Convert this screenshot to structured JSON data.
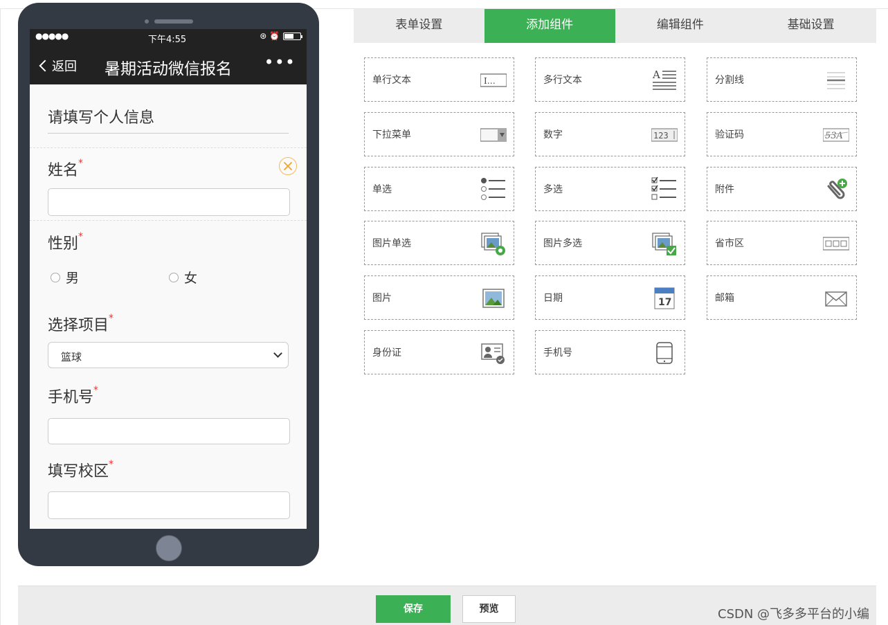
{
  "phone": {
    "status": {
      "signal": "●●●●●",
      "time": "下午4:55",
      "icons": "⊛ ⏰"
    },
    "nav": {
      "back_label": "返回",
      "title": "暑期活动微信报名",
      "more": "•••"
    },
    "form": {
      "heading": "请填写个人信息",
      "required_mark": "*",
      "name_label": "姓名",
      "gender_label": "性别",
      "gender_options": [
        "男",
        "女"
      ],
      "project_label": "选择项目",
      "project_selected": "篮球",
      "phone_label": "手机号",
      "campus_label": "填写校区"
    }
  },
  "tabs": [
    {
      "label": "表单设置",
      "active": false
    },
    {
      "label": "添加组件",
      "active": true
    },
    {
      "label": "编辑组件",
      "active": false
    },
    {
      "label": "基础设置",
      "active": false
    }
  ],
  "components": [
    {
      "label": "单行文本",
      "icon": "single-line-text-icon"
    },
    {
      "label": "多行文本",
      "icon": "multi-line-text-icon"
    },
    {
      "label": "分割线",
      "icon": "divider-icon"
    },
    {
      "label": "下拉菜单",
      "icon": "dropdown-icon"
    },
    {
      "label": "数字",
      "icon": "number-icon"
    },
    {
      "label": "验证码",
      "icon": "captcha-icon"
    },
    {
      "label": "单选",
      "icon": "radio-list-icon"
    },
    {
      "label": "多选",
      "icon": "checkbox-list-icon"
    },
    {
      "label": "附件",
      "icon": "attachment-icon"
    },
    {
      "label": "图片单选",
      "icon": "image-radio-icon"
    },
    {
      "label": "图片多选",
      "icon": "image-checkbox-icon"
    },
    {
      "label": "省市区",
      "icon": "region-icon"
    },
    {
      "label": "图片",
      "icon": "image-icon"
    },
    {
      "label": "日期",
      "icon": "calendar-icon"
    },
    {
      "label": "邮箱",
      "icon": "email-icon"
    },
    {
      "label": "身份证",
      "icon": "id-card-icon"
    },
    {
      "label": "手机号",
      "icon": "mobile-phone-icon"
    }
  ],
  "icon_text": {
    "single_line": "I…",
    "number": "123",
    "captcha": "53A",
    "calendar_day": "17"
  },
  "footer": {
    "save_label": "保存",
    "preview_label": "预览"
  },
  "watermark": "CSDN @飞多多平台的小编",
  "colors": {
    "accent": "#3cb054",
    "required": "#e33333",
    "phone_body": "#343a44"
  }
}
